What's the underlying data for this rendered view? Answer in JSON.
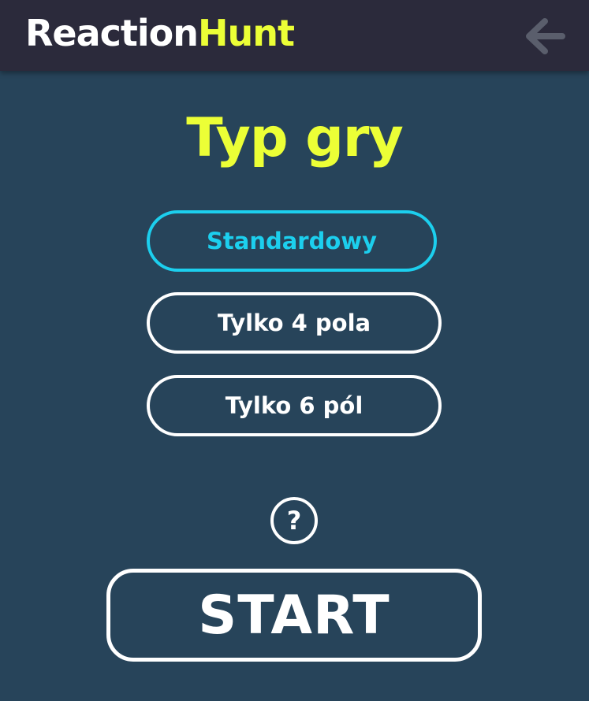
{
  "header": {
    "logo_part1": "Reaction",
    "logo_part2": "Hunt",
    "back_icon": "arrow-left-icon"
  },
  "main": {
    "title": "Typ gry",
    "options": [
      {
        "label": "Standardowy",
        "selected": true
      },
      {
        "label": "Tylko 4 pola",
        "selected": false
      },
      {
        "label": "Tylko 6 pól",
        "selected": false
      }
    ],
    "help_symbol": "?",
    "help_icon": "question-circle-icon",
    "start_label": "START"
  },
  "colors": {
    "background": "#27445a",
    "header_background": "#2b2a3b",
    "accent_yellow": "#ecff36",
    "selected_cyan": "#1ccfee",
    "text_white": "#ffffff",
    "back_arrow_gray": "#5a5e6c"
  }
}
